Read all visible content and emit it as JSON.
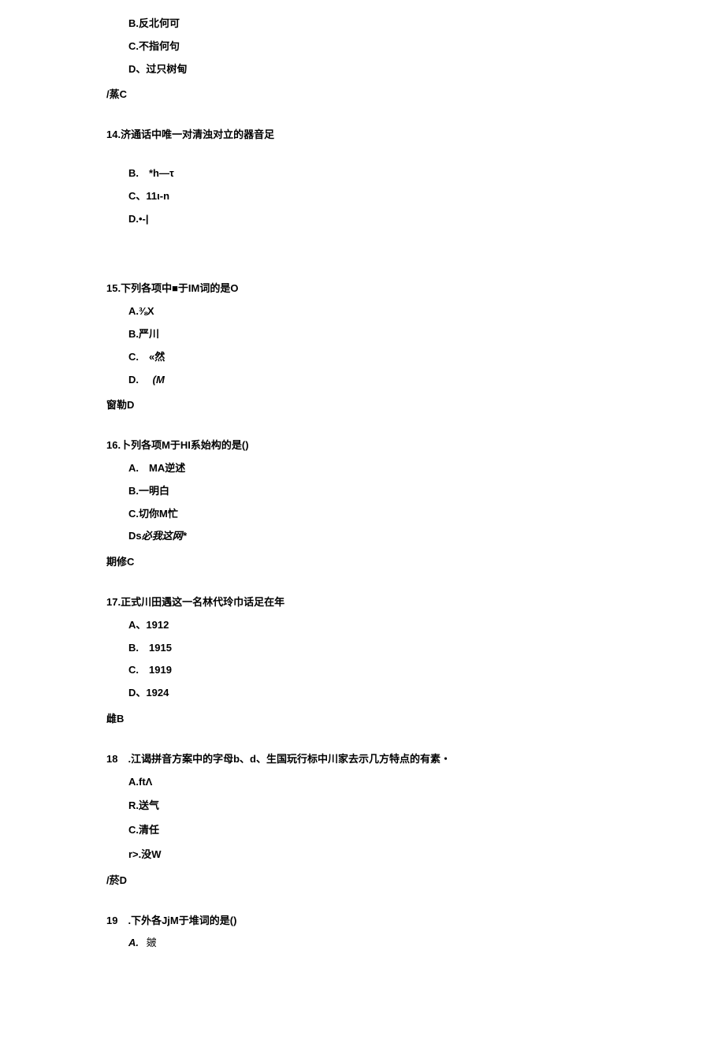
{
  "options_top": {
    "b": "B.反北何可",
    "c": "C.不指何句",
    "d": "D、过只树甸"
  },
  "answer_13": "/蒸C",
  "q14": {
    "title": "14.济通话中唯一对清浊对立的器音足",
    "b": "B.　*h—τ",
    "c": "C、11ι-n",
    "d": "D.•-|"
  },
  "q15": {
    "title": "15.下列各项中■于IM词的是O",
    "a": "A.⅜X",
    "b": "B.严川",
    "c": "C.　«然",
    "d_label": "D.",
    "d_value": "(M",
    "answer": "窗勒D"
  },
  "q16": {
    "title": "16.卜列各项M于HI系始构的是()",
    "a": "A.　MA逆述",
    "b": "B.一明白",
    "c": "C.切你M忙",
    "d_label": "Ds",
    "d_value": "必我这网*",
    "answer": "期修C"
  },
  "q17": {
    "title": "17.正式川田遇这一名林代玲巾话足在年",
    "a": "A、1912",
    "b": "B.　1915",
    "c": "C.　1919",
    "d": "D、1924",
    "answer": "雌B"
  },
  "q18": {
    "title": "18　.江谒拼音方案中的字母b、d、生国玩行标中川家去示几方特点的有素・",
    "a": "A.ftΛ",
    "b": "R.送气",
    "c": "C.清任",
    "d": "r>.没W",
    "answer": "/菸D"
  },
  "q19": {
    "title": "19　.下外各JjM于堆词的是()",
    "a_label": "A.",
    "a_value": "皴"
  }
}
